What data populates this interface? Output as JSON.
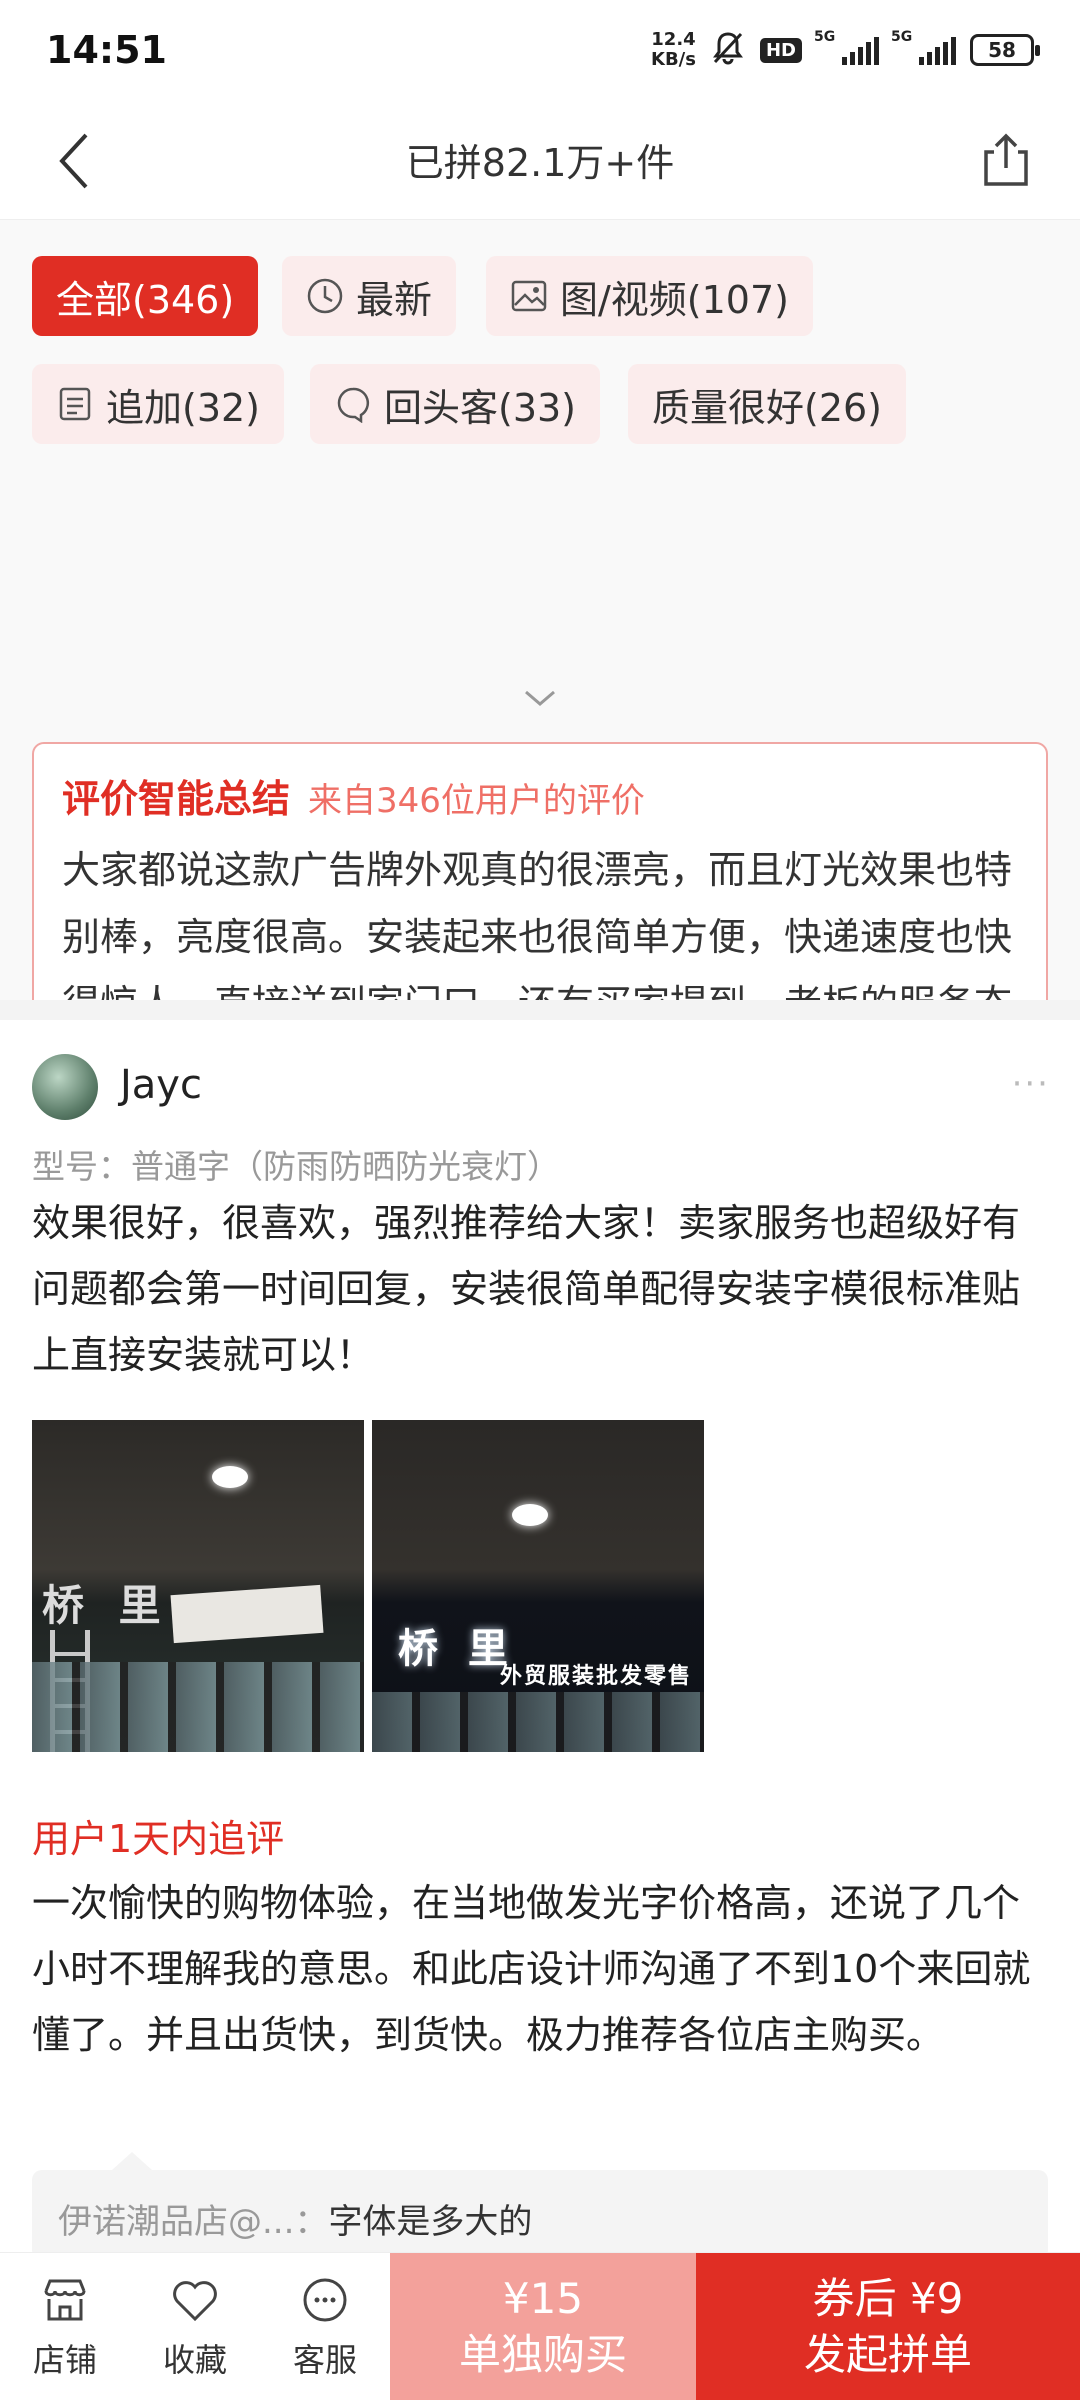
{
  "status": {
    "time": "14:51",
    "speed_value": "12.4",
    "speed_unit": "KB/s",
    "hd": "HD",
    "net1": "5G",
    "net2": "5G",
    "battery": "58"
  },
  "nav": {
    "title": "已拼82.1万+件"
  },
  "filters": [
    {
      "label": "全部(346)",
      "icon": "none",
      "active": true
    },
    {
      "label": "最新",
      "icon": "clock-icon",
      "active": false
    },
    {
      "label": "图/视频(107)",
      "icon": "image-icon",
      "active": false
    },
    {
      "label": "追加(32)",
      "icon": "note-icon",
      "active": false
    },
    {
      "label": "回头客(33)",
      "icon": "returning-icon",
      "active": false
    },
    {
      "label": "质量很好(26)",
      "icon": "none",
      "active": false
    }
  ],
  "summary": {
    "title": "评价智能总结",
    "source": "来自346位用户的评价",
    "text": "大家都说这款广告牌外观真的很漂亮，而且灯光效果也特别棒，亮度很高。安装起来也很简单方便，快递速度也快得惊人，直接送到家门口。还有买家提到，老板的服务态度超级好，耐心地教他们怎么装，价格方面也是物超所值，所以大家对这次购物体验",
    "expand": "展开"
  },
  "review": {
    "user": "Jayc",
    "more": "···",
    "model": "型号：普通字（防雨防晒防光衰灯）",
    "text": "效果很好，很喜欢，强烈推荐给大家！卖家服务也超级好有问题都会第一时间回复，安装很简单配得安装字模很标准贴上直接安装就可以！",
    "photo1_sign": "桥 里",
    "photo2_sign": "桥 里",
    "photo2_sub": "外贸服装批发零售",
    "followup_header": "用户1天内追评",
    "followup_text": "一次愉快的购物体验，在当地做发光字价格高，还说了几个小时不理解我的意思。和此店设计师沟通了不到10个来回就懂了。并且出货快，到货快。极力推荐各位店主购买。",
    "reply_who": "伊诺潮品店@...：",
    "reply_text": "字体是多大的"
  },
  "bottom": {
    "shop": "店铺",
    "fav": "收藏",
    "service": "客服",
    "buy_price": "¥15",
    "buy_label": "单独购买",
    "group_price": "券后 ¥9",
    "group_label": "发起拼单"
  },
  "colors": {
    "accent": "#e02e24",
    "accent_light": "#f3a19b",
    "chip_bg": "#fbecec"
  }
}
